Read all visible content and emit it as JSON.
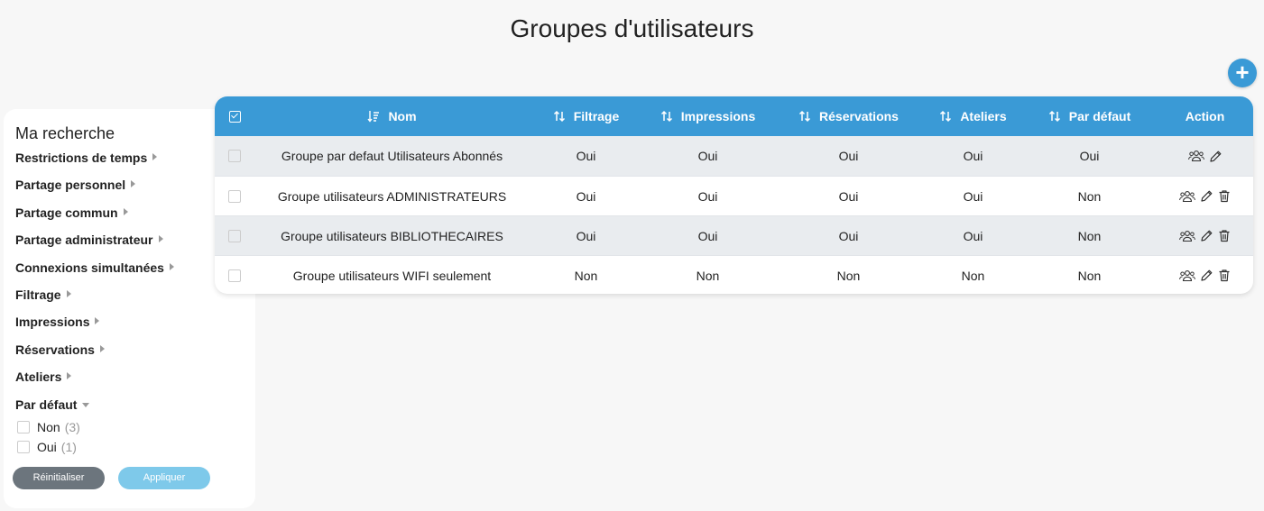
{
  "page": {
    "title": "Groupes d'utilisateurs",
    "add_button": "+"
  },
  "sidebar": {
    "title": "Ma recherche",
    "filters": [
      "Restrictions de temps",
      "Partage personnel",
      "Partage commun",
      "Partage administrateur",
      "Connexions simultanées",
      "Filtrage",
      "Impressions",
      "Réservations",
      "Ateliers"
    ],
    "expanded_filter": {
      "label": "Par défaut",
      "options": [
        {
          "label": "Non",
          "count": "(3)"
        },
        {
          "label": "Oui",
          "count": "(1)"
        }
      ]
    },
    "reset_label": "Réinitialiser",
    "apply_label": "Appliquer"
  },
  "table": {
    "columns": {
      "nom": "Nom",
      "filtrage": "Filtrage",
      "impressions": "Impressions",
      "reservations": "Réservations",
      "ateliers": "Ateliers",
      "par_defaut": "Par défaut",
      "action": "Action"
    },
    "rows": [
      {
        "nom": "Groupe par defaut Utilisateurs Abonnés",
        "filtrage": "Oui",
        "impressions": "Oui",
        "reservations": "Oui",
        "ateliers": "Oui",
        "par_defaut": "Oui"
      },
      {
        "nom": "Groupe utilisateurs ADMINISTRATEURS",
        "filtrage": "Oui",
        "impressions": "Oui",
        "reservations": "Oui",
        "ateliers": "Oui",
        "par_defaut": "Non"
      },
      {
        "nom": "Groupe utilisateurs BIBLIOTHECAIRES",
        "filtrage": "Oui",
        "impressions": "Oui",
        "reservations": "Oui",
        "ateliers": "Oui",
        "par_defaut": "Non"
      },
      {
        "nom": "Groupe utilisateurs WIFI seulement",
        "filtrage": "Non",
        "impressions": "Non",
        "reservations": "Non",
        "ateliers": "Non",
        "par_defaut": "Non"
      }
    ],
    "row_actions": [
      [
        "users-icon",
        "pencil-icon"
      ],
      [
        "users-icon",
        "pencil-icon",
        "trash-icon"
      ],
      [
        "users-icon",
        "pencil-icon",
        "trash-icon"
      ],
      [
        "users-icon",
        "pencil-icon",
        "trash-icon"
      ]
    ]
  },
  "colors": {
    "header_blue": "#3a9ad6",
    "shaded_row": "#e9ecef",
    "reset_gray": "#6c757d",
    "apply_light_blue": "#7ec9ea"
  }
}
